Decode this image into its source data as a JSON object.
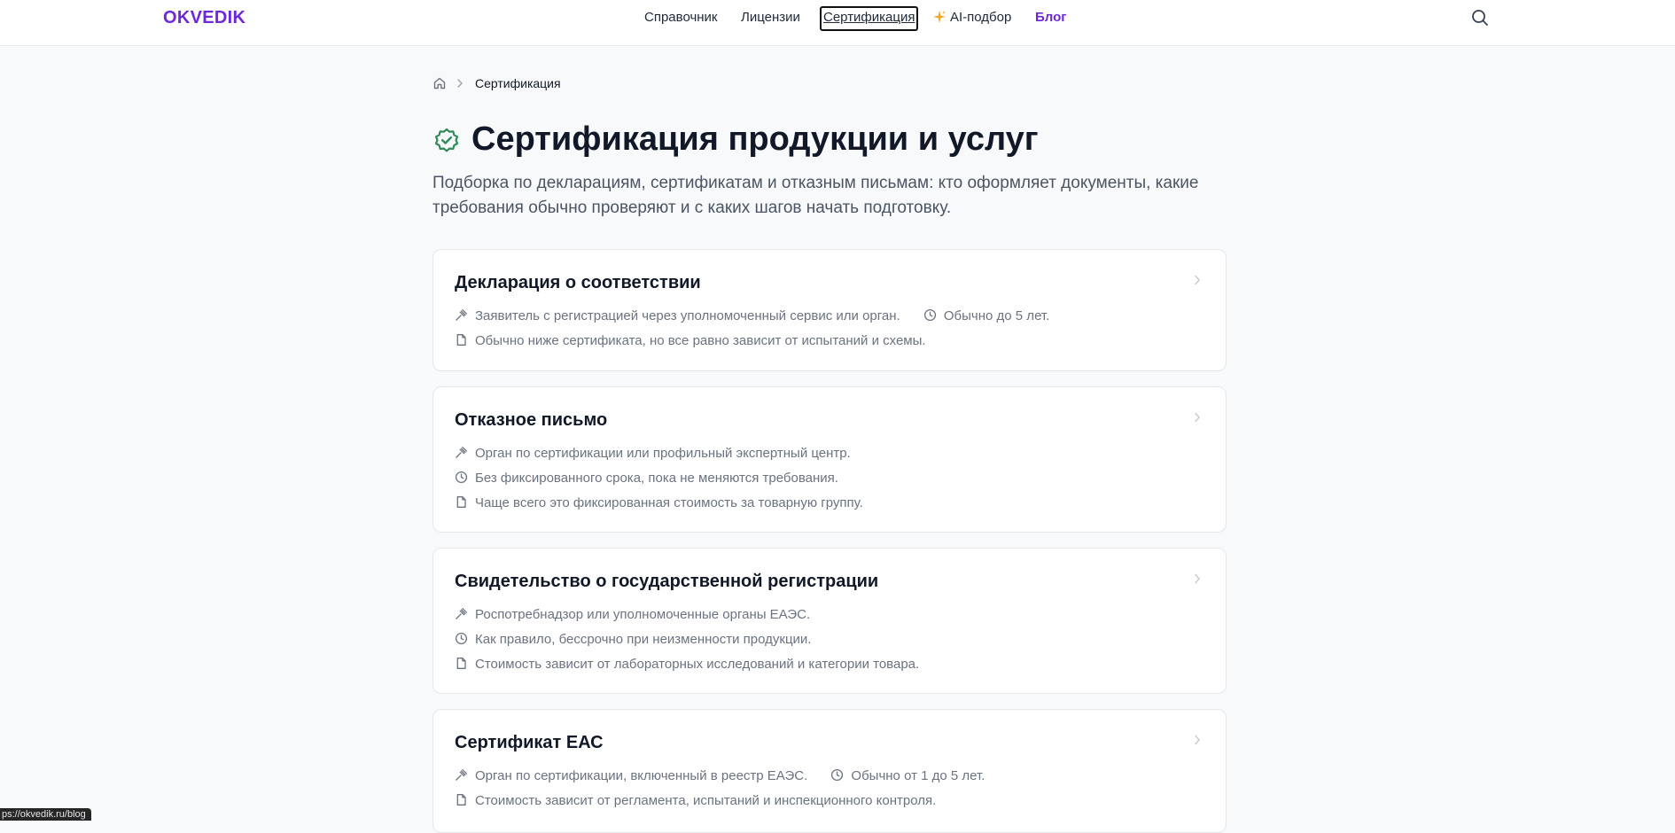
{
  "header": {
    "logo": "OKVEDIK",
    "nav": [
      {
        "label": "Справочник"
      },
      {
        "label": "Лицензии"
      },
      {
        "label": "Сертификация"
      },
      {
        "label": "AI-подбор",
        "icon": "sparkle-icon"
      },
      {
        "label": "Блог"
      }
    ],
    "search_icon": "search-icon",
    "accent_color": "#6d28d9"
  },
  "breadcrumb": {
    "home_icon": "home-icon",
    "current": "Сертификация"
  },
  "page": {
    "title": "Сертификация продукции и услуг",
    "title_icon": "badge-check-icon",
    "title_icon_color": "#2f8a57",
    "subtitle": "Подборка по декларациям, сертификатам и отказным письмам: кто оформляет документы, какие требования обычно проверяют и с каких шагов начать подготовку."
  },
  "cards": [
    {
      "title": "Декларация о соответствии",
      "rows": [
        [
          {
            "icon": "gavel-icon",
            "text": "Заявитель с регистрацией через уполномоченный сервис или орган."
          },
          {
            "icon": "clock-icon",
            "text": "Обычно до 5 лет."
          }
        ],
        [
          {
            "icon": "document-icon",
            "text": "Обычно ниже сертификата, но все равно зависит от испытаний и схемы."
          }
        ]
      ]
    },
    {
      "title": "Отказное письмо",
      "rows": [
        [
          {
            "icon": "gavel-icon",
            "text": "Орган по сертификации или профильный экспертный центр."
          }
        ],
        [
          {
            "icon": "clock-icon",
            "text": "Без фиксированного срока, пока не меняются требования."
          }
        ],
        [
          {
            "icon": "document-icon",
            "text": "Чаще всего это фиксированная стоимость за товарную группу."
          }
        ]
      ]
    },
    {
      "title": "Свидетельство о государственной регистрации",
      "rows": [
        [
          {
            "icon": "gavel-icon",
            "text": "Роспотребнадзор или уполномоченные органы ЕАЭС."
          }
        ],
        [
          {
            "icon": "clock-icon",
            "text": "Как правило, бессрочно при неизменности продукции."
          }
        ],
        [
          {
            "icon": "document-icon",
            "text": "Стоимость зависит от лабораторных исследований и категории товара."
          }
        ]
      ]
    },
    {
      "title": "Сертификат ЕАС",
      "rows": [
        [
          {
            "icon": "gavel-icon",
            "text": "Орган по сертификации, включенный в реестр ЕАЭС."
          },
          {
            "icon": "clock-icon",
            "text": "Обычно от 1 до 5 лет."
          }
        ],
        [
          {
            "icon": "document-icon",
            "text": "Стоимость зависит от регламента, испытаний и инспекционного контроля."
          }
        ]
      ]
    }
  ],
  "status_bar": {
    "url": "ps://okvedik.ru/blog"
  }
}
